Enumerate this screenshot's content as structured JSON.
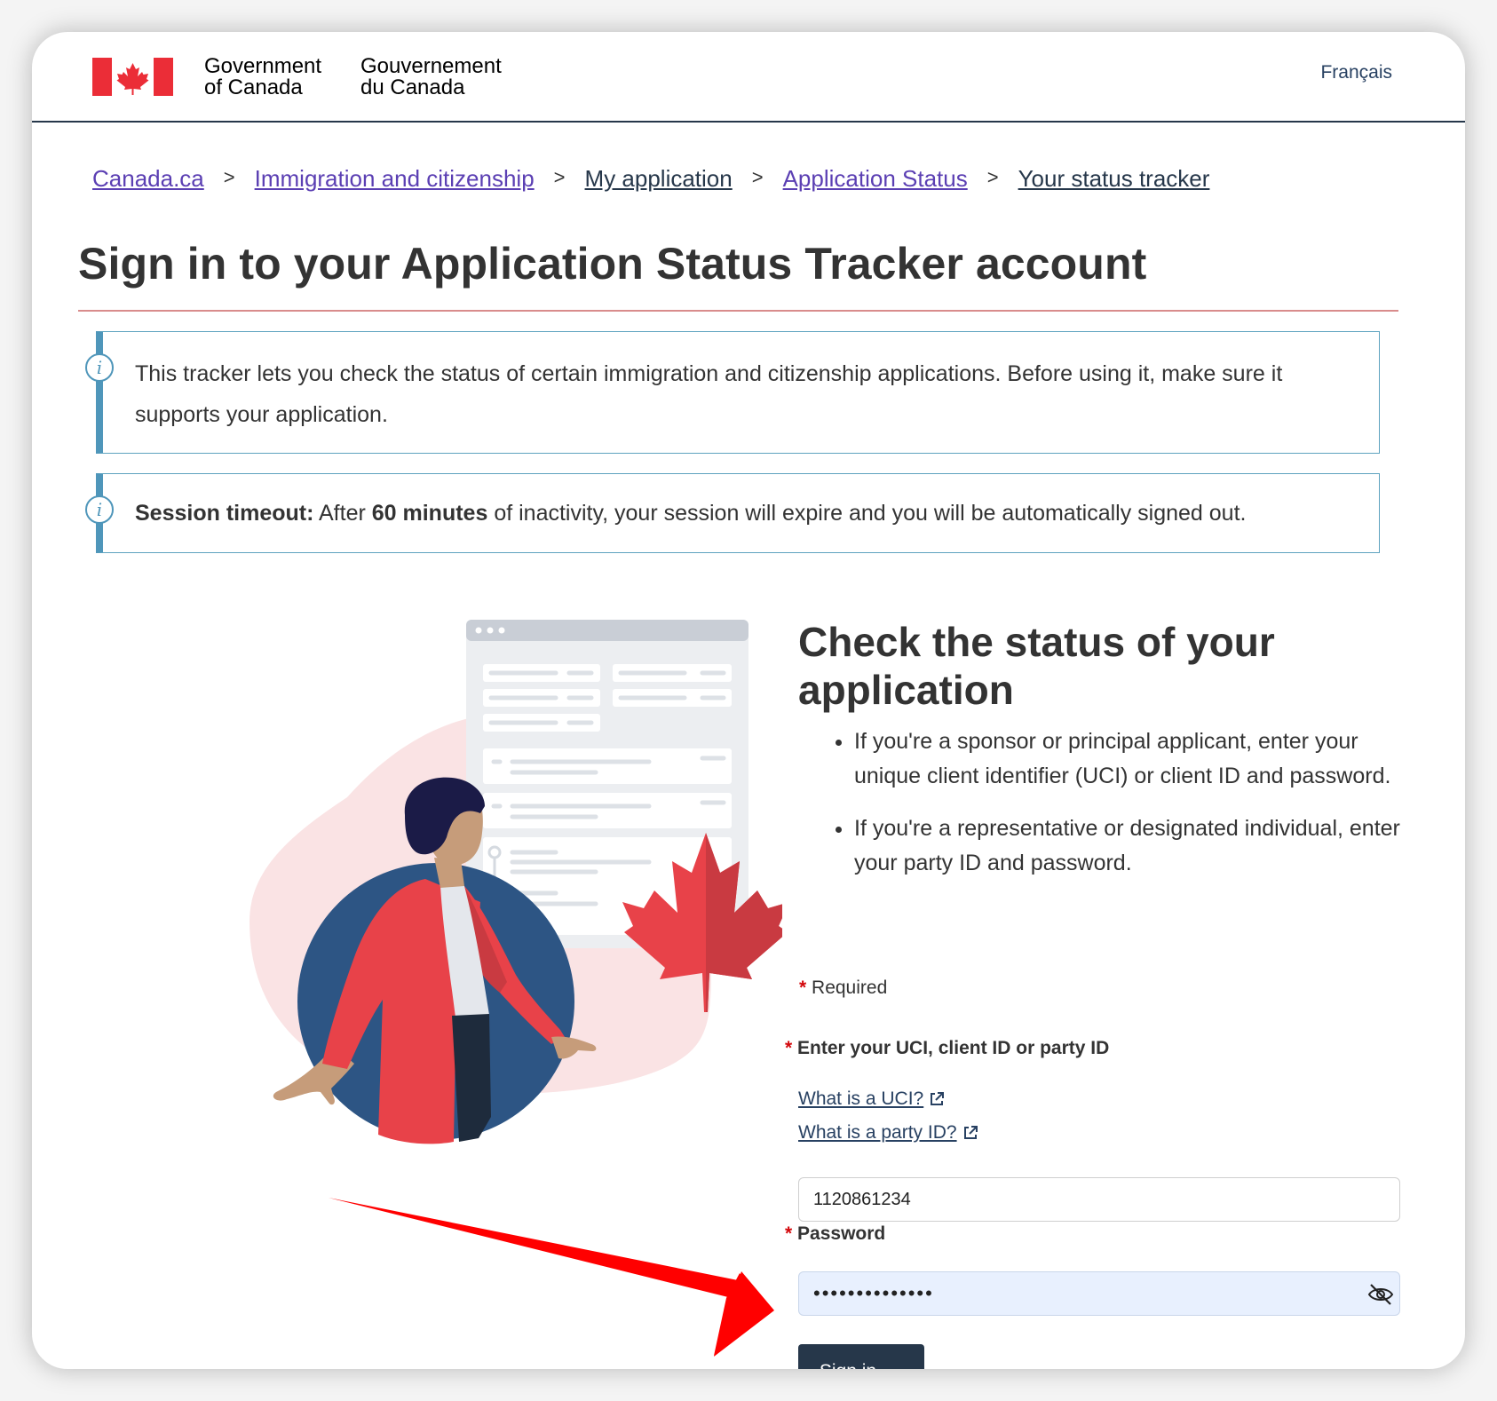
{
  "header": {
    "signature_en_line1": "Government",
    "signature_en_line2": "of Canada",
    "signature_fr_line1": "Gouvernement",
    "signature_fr_line2": "du Canada",
    "language_toggle": "Français"
  },
  "breadcrumb": [
    "Canada.ca",
    "Immigration and citizenship",
    "My application",
    "Application Status",
    "Your status tracker"
  ],
  "breadcrumb_separator": ">",
  "page_title": "Sign in to your Application Status Tracker account",
  "alerts": {
    "info_text": "This tracker lets you check the status of certain immigration and citizenship applications. Before using it, make sure it supports your application.",
    "timeout_label": "Session timeout:",
    "timeout_pre": "After",
    "timeout_minutes": "60 minutes",
    "timeout_post": "of inactivity, your session will expire and you will be automatically signed out."
  },
  "form": {
    "heading": "Check the status of your application",
    "bullets": [
      "If you're a sponsor or principal applicant, enter your unique client identifier (UCI) or client ID and password.",
      "If you're a representative or designated individual, enter your party ID and password."
    ],
    "required_marker": "*",
    "required_note": "Required",
    "uci_label": "Enter your UCI, client ID or party ID",
    "uci_help_link": "What is a UCI?",
    "party_help_link": "What is a party ID?",
    "uci_value": "1120861234",
    "password_label": "Password",
    "password_value": "••••••••••••••",
    "sign_in_button": "Sign in",
    "sign_in_arrow": "→"
  },
  "colors": {
    "brand_navy": "#26374a",
    "link_purple": "#5b3fb3",
    "required_red": "#d3080c",
    "alert_blue": "#4f96ba",
    "annotation_arrow": "#ff0000"
  },
  "icons": [
    "canada-flag-icon",
    "info-icon",
    "external-link-icon",
    "eye-slash-icon",
    "arrow-right-icon"
  ]
}
